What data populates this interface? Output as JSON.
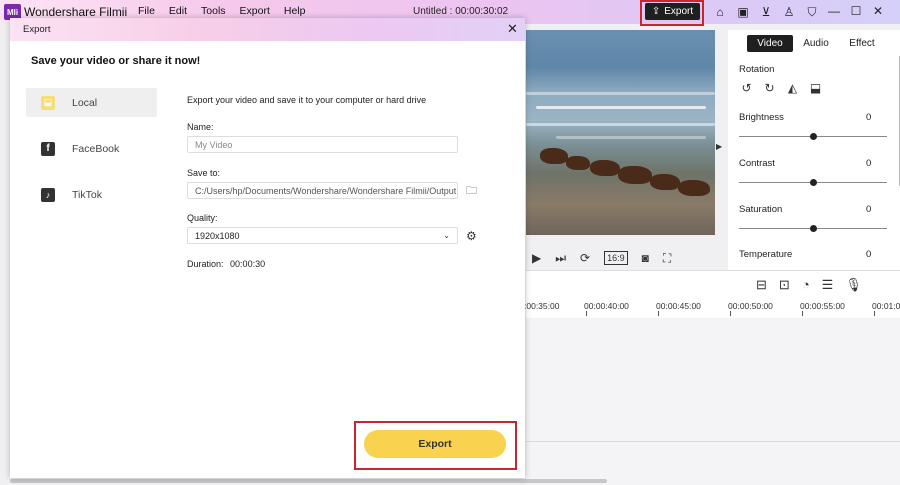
{
  "app": {
    "logo_text": "Mli",
    "name": "Wondershare Filmii",
    "project_title": "Untitled :  00:00:30:02",
    "menu": [
      "File",
      "Edit",
      "Tools",
      "Export",
      "Help"
    ],
    "export_button_label": "Export",
    "toolbar_icons": [
      "home-icon",
      "save-icon",
      "cart-icon",
      "account-icon",
      "shirt-icon"
    ]
  },
  "right_panel": {
    "tabs": [
      "Video",
      "Audio",
      "Effect"
    ],
    "active_tab": "Video",
    "rotation_label": "Rotation",
    "adjustments": [
      {
        "label": "Brightness",
        "value": "0",
        "level": 0.5
      },
      {
        "label": "Contrast",
        "value": "0",
        "level": 0.5
      },
      {
        "label": "Saturation",
        "value": "0",
        "level": 0.5
      },
      {
        "label": "Temperature",
        "value": "0",
        "level": 0.5
      }
    ]
  },
  "player": {
    "aspect_ratio": "16:9"
  },
  "timeline": {
    "ruler_labels": [
      ":00:35:00",
      "00:00:40:00",
      "00:00:45:00",
      "00:00:50:00",
      "00:00:55:00",
      "00:01:0"
    ]
  },
  "export_dialog": {
    "title": "Export",
    "heading": "Save your video or share it now!",
    "destinations": [
      {
        "label": "Local",
        "icon": "local-icon",
        "active": true
      },
      {
        "label": "FaceBook",
        "icon": "facebook-icon",
        "active": false
      },
      {
        "label": "TikTok",
        "icon": "tiktok-icon",
        "active": false
      }
    ],
    "description": "Export your video and save it to your computer or hard drive",
    "name_label": "Name:",
    "name_placeholder": "My Video",
    "save_to_label": "Save to:",
    "save_to_path": "C:/Users/hp/Documents/Wondershare/Wondershare Filmii/Output",
    "quality_label": "Quality:",
    "quality_value": "1920x1080",
    "duration_label": "Duration:",
    "duration_value": "00:00:30",
    "export_button": "Export"
  },
  "colors": {
    "export_button_bg": "#f9d34f",
    "highlight_border": "#c8262e",
    "active_tab_bg": "#1f1f1f"
  }
}
